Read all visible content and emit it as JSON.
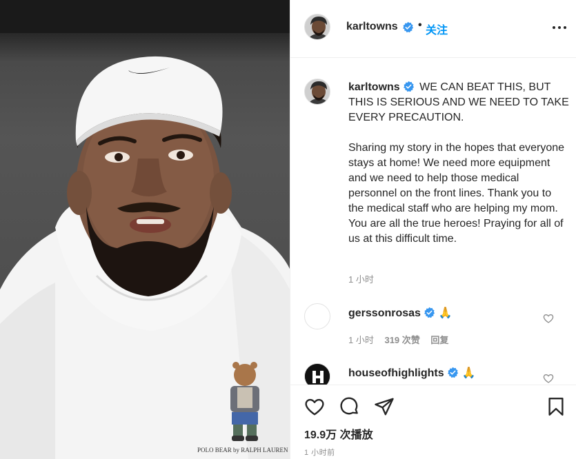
{
  "header": {
    "username": "karltowns",
    "separator": "•",
    "follow_label": "关注"
  },
  "caption": {
    "username": "karltowns",
    "headline": "WE CAN BEAT THIS, BUT THIS IS SERIOUS AND WE NEED TO TAKE EVERY PRECAUTION.",
    "body": "Sharing my story in the hopes that everyone stays at home! We need more equipment and we need to help those medical personnel on the front lines. Thank you to the medical staff who are helping my mom. You are all the true heroes! Praying for all of us at this difficult time.",
    "time": "1 小时"
  },
  "comments": [
    {
      "username": "gerssonrosas",
      "emoji": "🙏",
      "time": "1 小时",
      "likes": "319 次赞",
      "reply_label": "回复"
    },
    {
      "username": "houseofhighlights",
      "emoji": "🙏"
    }
  ],
  "media": {
    "hoodie_print_text": "POLO BEAR by RALPH LAUREN"
  },
  "stats": {
    "views": "19.9万 次播放",
    "post_time": "1 小时前"
  },
  "colors": {
    "link": "#0095f6",
    "verified": "#3897f0",
    "meta": "#8e8e8e",
    "text": "#262626"
  }
}
